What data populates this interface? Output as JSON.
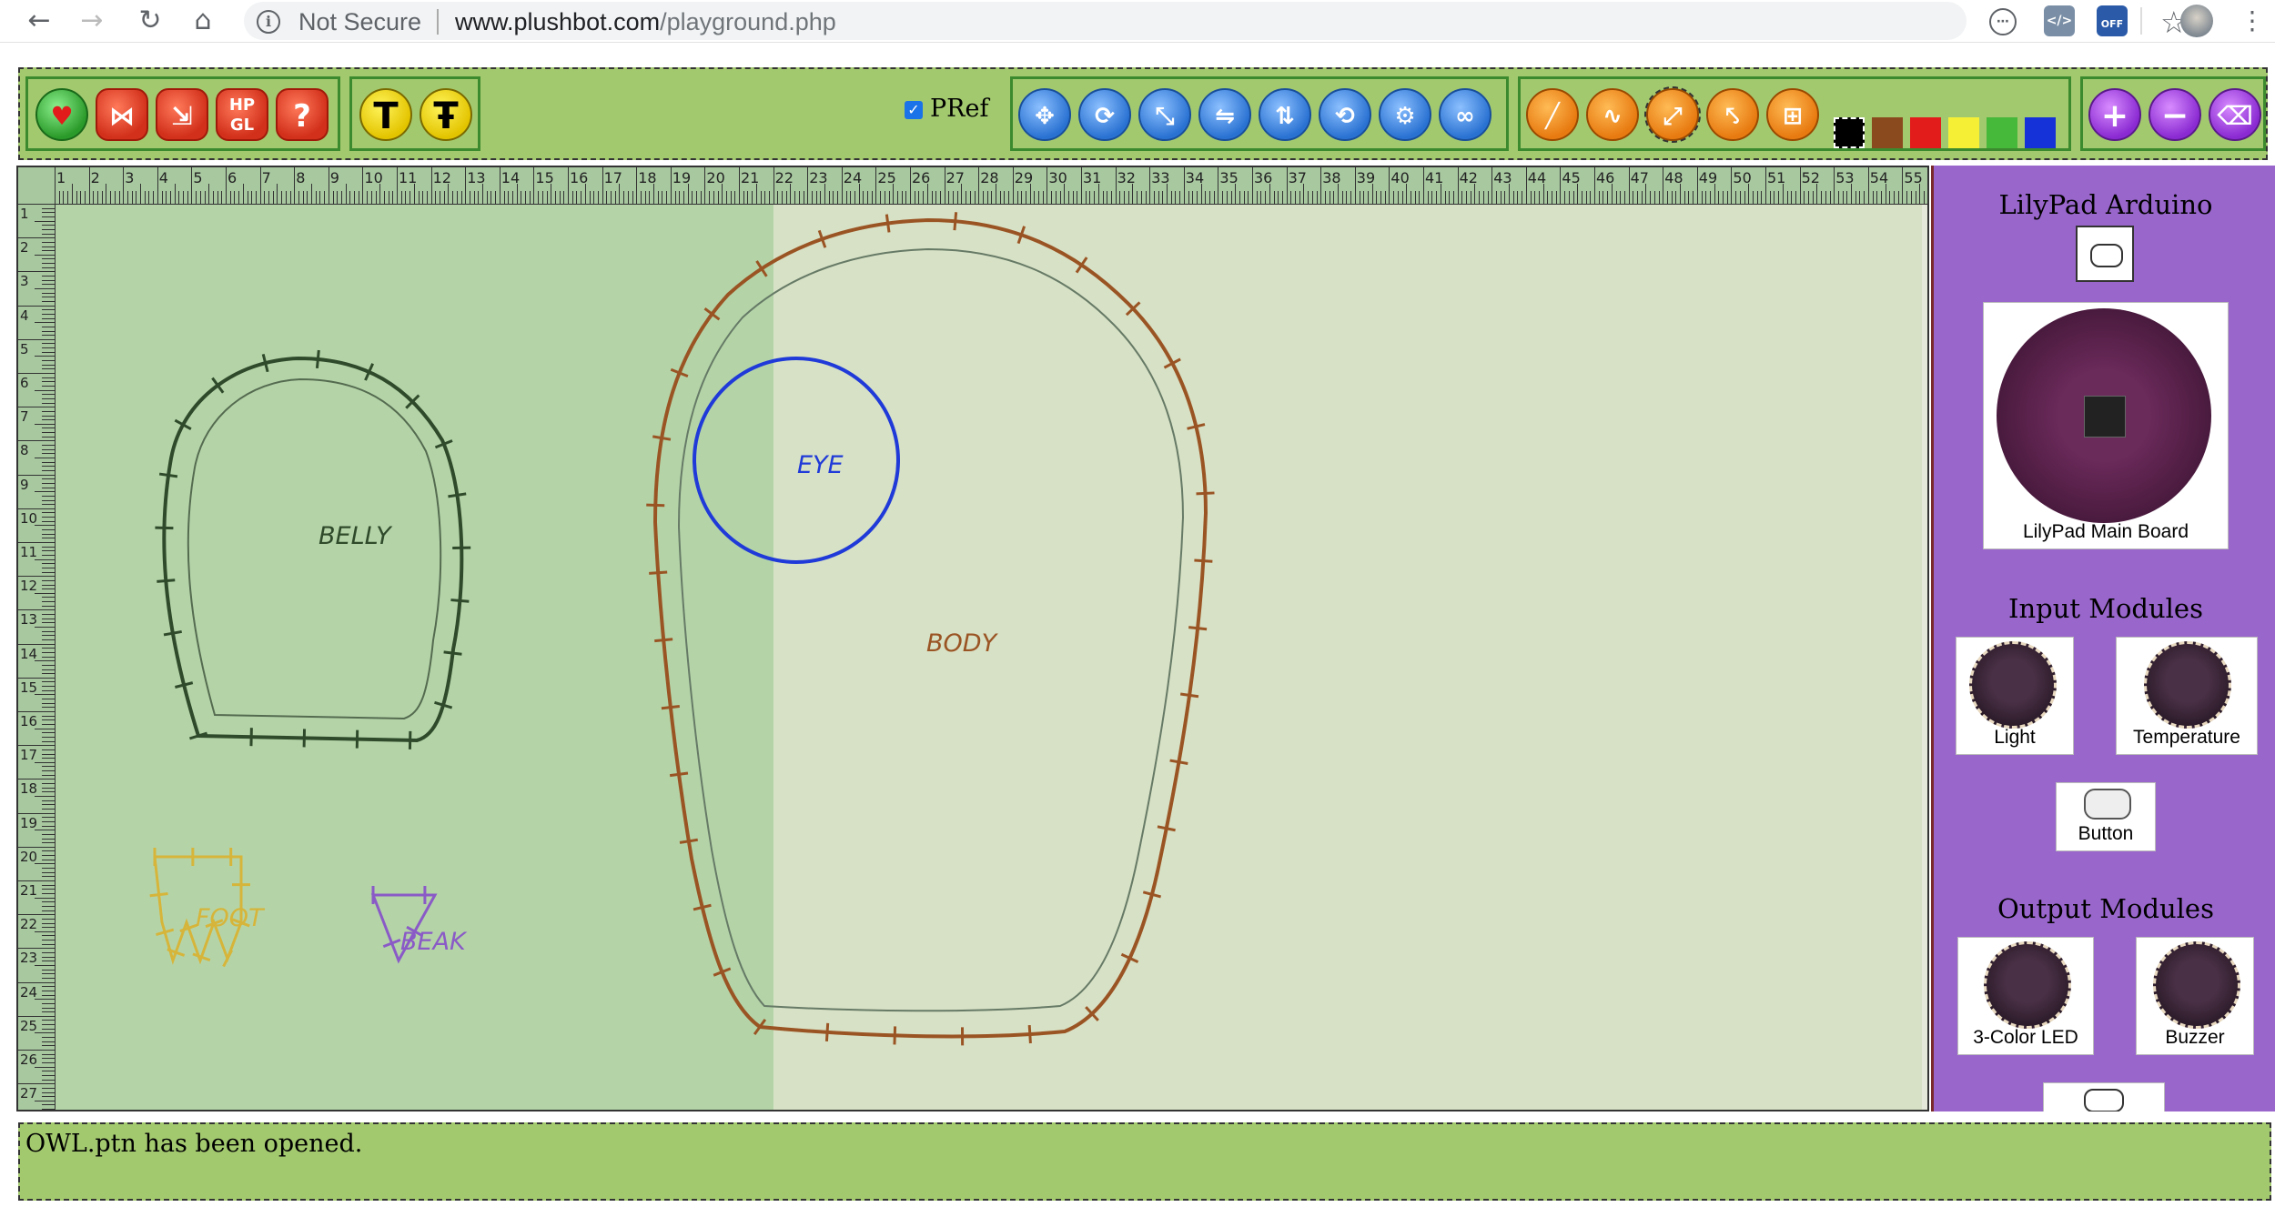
{
  "browser": {
    "security_label": "Not Secure",
    "url_host": "www.plushbot.com",
    "url_path": "/playground.php",
    "ext_off_label": "OFF"
  },
  "toolbar": {
    "file_buttons": [
      {
        "name": "open-icon",
        "glyph": "♥"
      },
      {
        "name": "butterfly-icon",
        "glyph": "⋈"
      },
      {
        "name": "export-icon",
        "glyph": "⇲"
      },
      {
        "name": "hpgl-icon",
        "glyph": "HP GL"
      },
      {
        "name": "help-icon",
        "glyph": "?"
      }
    ],
    "text_buttons": [
      "T",
      "Ŧ"
    ],
    "pref_label": "PRef",
    "transform_buttons": [
      "move-icon",
      "rotate-icon",
      "scale-icon",
      "flip-horizontal-icon",
      "flip-vertical-icon",
      "rotate-point-icon",
      "settings-icon",
      "link-icon"
    ],
    "draw_buttons": [
      "line-icon",
      "curve-icon",
      "dashed-line-icon",
      "branch-icon",
      "stitch-icon"
    ],
    "colors": [
      "#000000",
      "#8b4a1e",
      "#e21b1b",
      "#f5f036",
      "#46b83a",
      "#1531d8"
    ],
    "zoom_buttons": [
      "zoom-in-icon",
      "zoom-out-icon",
      "clear-icon"
    ]
  },
  "canvas": {
    "ruler_top_numbers": [
      "1",
      "2",
      "3",
      "4",
      "5",
      "6",
      "7",
      "8",
      "9",
      "10",
      "11",
      "12",
      "13",
      "14",
      "15",
      "16",
      "17",
      "18",
      "19",
      "20",
      "21",
      "22",
      "23",
      "24",
      "25",
      "26",
      "27",
      "28",
      "29",
      "30",
      "31",
      "32",
      "33",
      "34",
      "35",
      "36",
      "37",
      "38",
      "39",
      "40",
      "41",
      "42",
      "43",
      "44",
      "45",
      "46",
      "47",
      "48",
      "49",
      "50",
      "51",
      "52",
      "53",
      "54",
      "55"
    ],
    "ruler_left_numbers": [
      "1",
      "2",
      "3",
      "4",
      "5",
      "6",
      "7",
      "8",
      "9",
      "10",
      "11",
      "12",
      "13",
      "14",
      "15",
      "16",
      "17",
      "18",
      "19",
      "20",
      "21",
      "22",
      "23",
      "24",
      "25",
      "26",
      "27"
    ],
    "pieces": {
      "belly": {
        "label": "BELLY",
        "color": "#2f4a2a"
      },
      "body": {
        "label": "BODY",
        "color": "#9a5424"
      },
      "eye": {
        "label": "EYE",
        "color": "#1f3ad8"
      },
      "foot": {
        "label": "FOOT",
        "color": "#d6b53a"
      },
      "beak": {
        "label": "BEAK",
        "color": "#8a5ac6"
      }
    }
  },
  "sidebar": {
    "section_main": "LilyPad Arduino",
    "main_board_label": "LilyPad Main Board",
    "section_input": "Input Modules",
    "input_modules": [
      "Light",
      "Temperature",
      "Button"
    ],
    "section_output": "Output Modules",
    "output_modules": [
      "3-Color LED",
      "Buzzer"
    ]
  },
  "status": {
    "message": "OWL.ptn has been opened."
  }
}
